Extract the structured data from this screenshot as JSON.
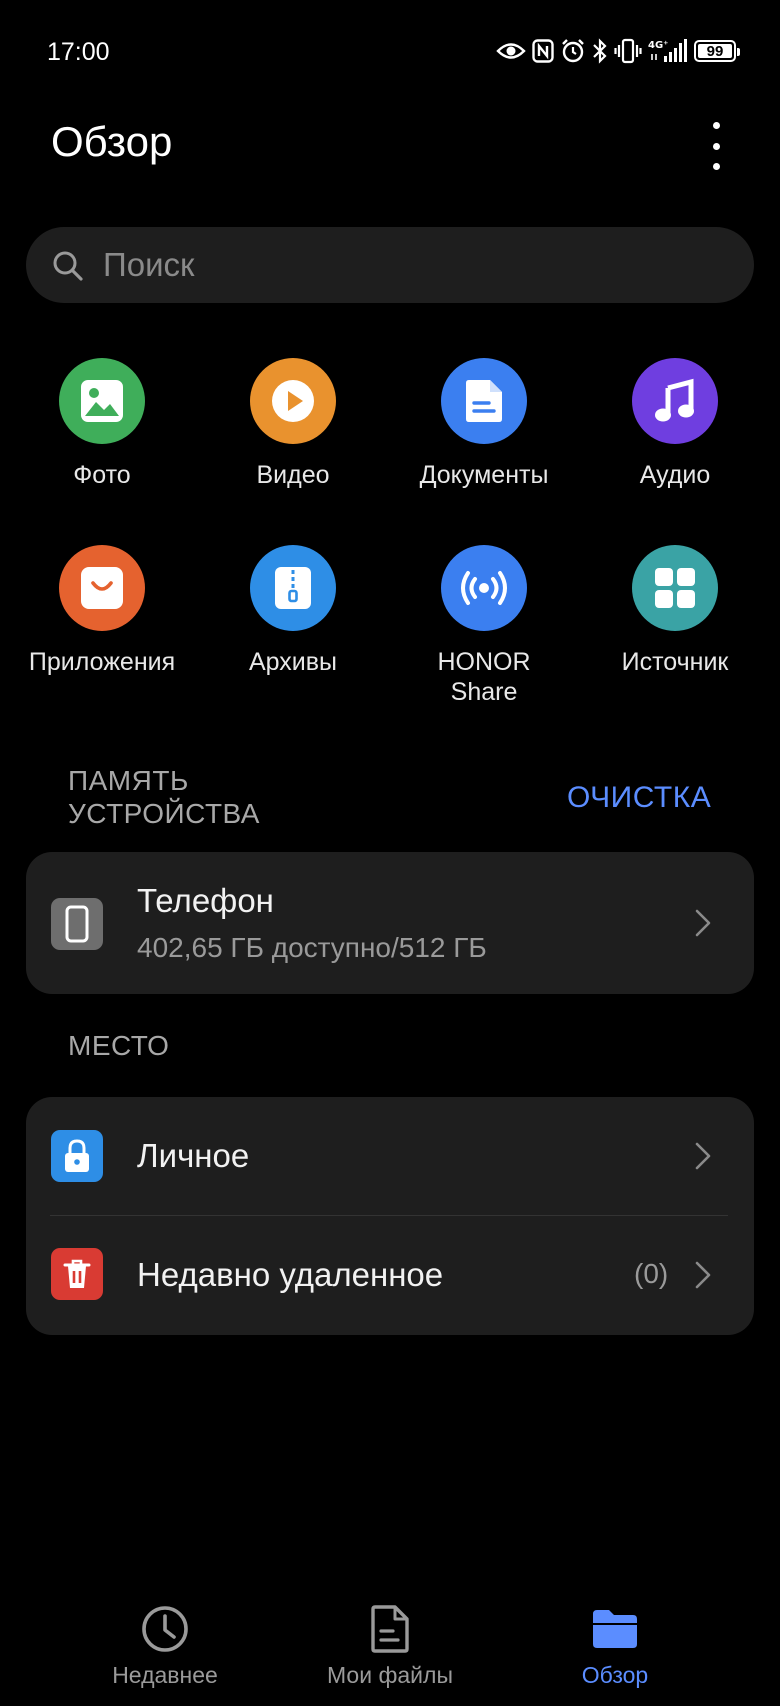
{
  "status_bar": {
    "time": "17:00",
    "battery": "99",
    "battery_level": 0.99,
    "icons": [
      "eye-icon",
      "nfc-icon",
      "alarm-icon",
      "bluetooth-icon",
      "vibrate-icon",
      "signal-4g-icon",
      "battery-icon"
    ]
  },
  "header": {
    "title": "Обзор",
    "more_icon": "more-vertical-icon"
  },
  "search": {
    "placeholder": "Поиск",
    "icon": "search-icon"
  },
  "categories": [
    {
      "label": "Фото",
      "icon": "photo-icon",
      "color": "#3fae5a"
    },
    {
      "label": "Видео",
      "icon": "play-icon",
      "color": "#e9922e"
    },
    {
      "label": "Документы",
      "icon": "document-icon",
      "color": "#3b7ff0"
    },
    {
      "label": "Аудио",
      "icon": "music-icon",
      "color": "#6f3ee0"
    },
    {
      "label": "Приложения",
      "icon": "shopping-bag-icon",
      "color": "#e5622f"
    },
    {
      "label": "Архивы",
      "icon": "archive-icon",
      "color": "#2e8ee6"
    },
    {
      "label": "HONOR Share",
      "icon": "broadcast-icon",
      "color": "#3b7ff0"
    },
    {
      "label": "Источник",
      "icon": "grid-icon",
      "color": "#3aa3a5"
    }
  ],
  "device_storage": {
    "section_title": "ПАМЯТЬ УСТРОЙСТВА",
    "cleanup_label": "ОЧИСТКА",
    "phone": {
      "title": "Телефон",
      "subtitle": "402,65 ГБ доступно/512 ГБ"
    }
  },
  "places": {
    "section_title": "МЕСТО",
    "items": [
      {
        "label": "Личное",
        "icon": "lock-icon",
        "color": "#2e8ee6",
        "count": ""
      },
      {
        "label": "Недавно удаленное",
        "icon": "trash-icon",
        "color": "#d93b33",
        "count": "(0)"
      }
    ]
  },
  "bottom_nav": {
    "items": [
      {
        "label": "Недавнее",
        "icon": "clock-icon",
        "active": false
      },
      {
        "label": "Мои файлы",
        "icon": "file-icon",
        "active": false
      },
      {
        "label": "Обзор",
        "icon": "folder-icon",
        "active": true
      }
    ],
    "active_color": "#5b8dff"
  }
}
